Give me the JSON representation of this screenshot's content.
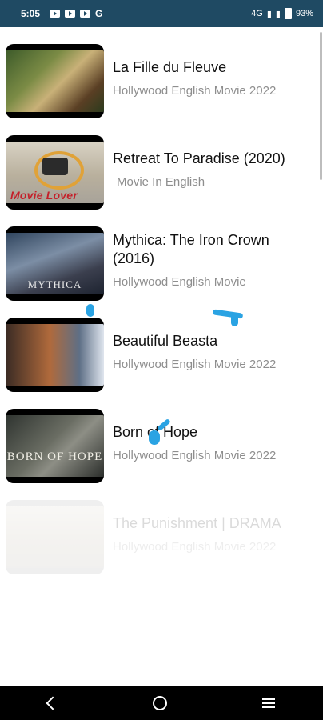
{
  "status": {
    "time": "5:05",
    "left_icons": [
      "youtube-icon",
      "youtube-icon",
      "youtube-icon",
      "google-icon"
    ],
    "google_label": "G",
    "network": "4G",
    "battery": "93%"
  },
  "movies": [
    {
      "title": "La Fille du Fleuve",
      "subtitle": "Hollywood English Movie 2022"
    },
    {
      "title": "Retreat To Paradise (2020)",
      "subtitle": "Movie In English",
      "thumb_text": "Movie Lover"
    },
    {
      "title": "Mythica: The Iron Crown (2016)",
      "subtitle": "Hollywood English Movie",
      "thumb_text": "MYTHICA"
    },
    {
      "title": "Beautiful Beasta",
      "subtitle": "Hollywood English Movie 2022"
    },
    {
      "title": "Born of Hope",
      "subtitle": "Hollywood English Movie 2022",
      "thumb_text": "BORN OF HOPE"
    },
    {
      "title": "The Punishment | DRAMA",
      "subtitle": "Hollywood English Movie 2022"
    }
  ],
  "colors": {
    "status_bar": "#1f4a63",
    "title": "#111111",
    "subtitle": "#8e8e8e",
    "touch_mark": "#2aa3e3"
  },
  "nav": {
    "back": "back-icon",
    "home": "home-icon",
    "recents": "menu-icon"
  }
}
